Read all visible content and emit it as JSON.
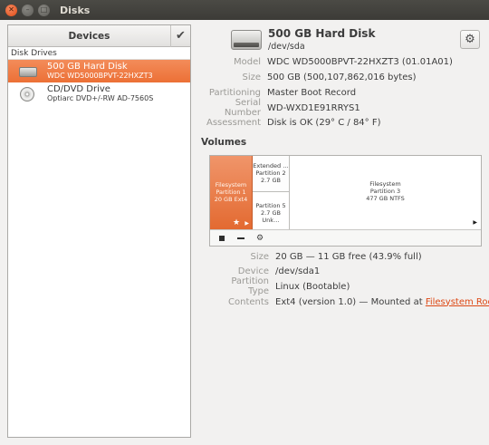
{
  "window": {
    "title": "Disks",
    "close_glyph": "✕",
    "minimize_glyph": "–",
    "maximize_glyph": "□"
  },
  "sidebar": {
    "header": "Devices",
    "header_check_glyph": "✔",
    "group_label": "Disk Drives",
    "items": [
      {
        "name": "500 GB Hard Disk",
        "sub": "WDC WD5000BPVT-22HXZT3",
        "icon": "hard-disk-icon",
        "selected": true
      },
      {
        "name": "CD/DVD Drive",
        "sub": "Optiarc DVD+/-RW AD-7560S",
        "icon": "optical-drive-icon",
        "selected": false
      }
    ]
  },
  "disk": {
    "title": "500 GB Hard Disk",
    "device": "/dev/sda",
    "gear_glyph": "⚙",
    "rows": [
      {
        "label": "Model",
        "value": "WDC WD5000BPVT-22HXZT3 (01.01A01)"
      },
      {
        "label": "Size",
        "value": "500 GB (500,107,862,016 bytes)"
      },
      {
        "label": "Partitioning",
        "value": "Master Boot Record"
      },
      {
        "label": "Serial Number",
        "value": "WD-WXD1E91RRYS1"
      },
      {
        "label": "Assessment",
        "value": "Disk is OK (29° C / 84° F)"
      }
    ]
  },
  "volumes": {
    "title": "Volumes",
    "partition1": {
      "line1": "Filesystem",
      "line2": "Partition 1",
      "line3": "20 GB Ext4"
    },
    "extended": {
      "line1": "Extended …",
      "line2": "Partition 2",
      "line3": "2.7 GB"
    },
    "partition5": {
      "line1": "Partition 5",
      "line2": "2.7 GB Unk…"
    },
    "partition3": {
      "line1": "Filesystem",
      "line2": "Partition 3",
      "line3": "477 GB NTFS"
    },
    "star_glyph": "★",
    "play_glyph": "▶",
    "toolbar_gear_glyph": "⚙"
  },
  "selected_volume": {
    "rows": [
      {
        "label": "Size",
        "value": "20 GB — 11 GB free (43.9% full)"
      },
      {
        "label": "Device",
        "value": "/dev/sda1"
      },
      {
        "label": "Partition Type",
        "value": "Linux (Bootable)"
      }
    ],
    "contents_label": "Contents",
    "contents_prefix": "Ext4 (version 1.0) — Mounted at ",
    "contents_link": "Filesystem Root"
  }
}
